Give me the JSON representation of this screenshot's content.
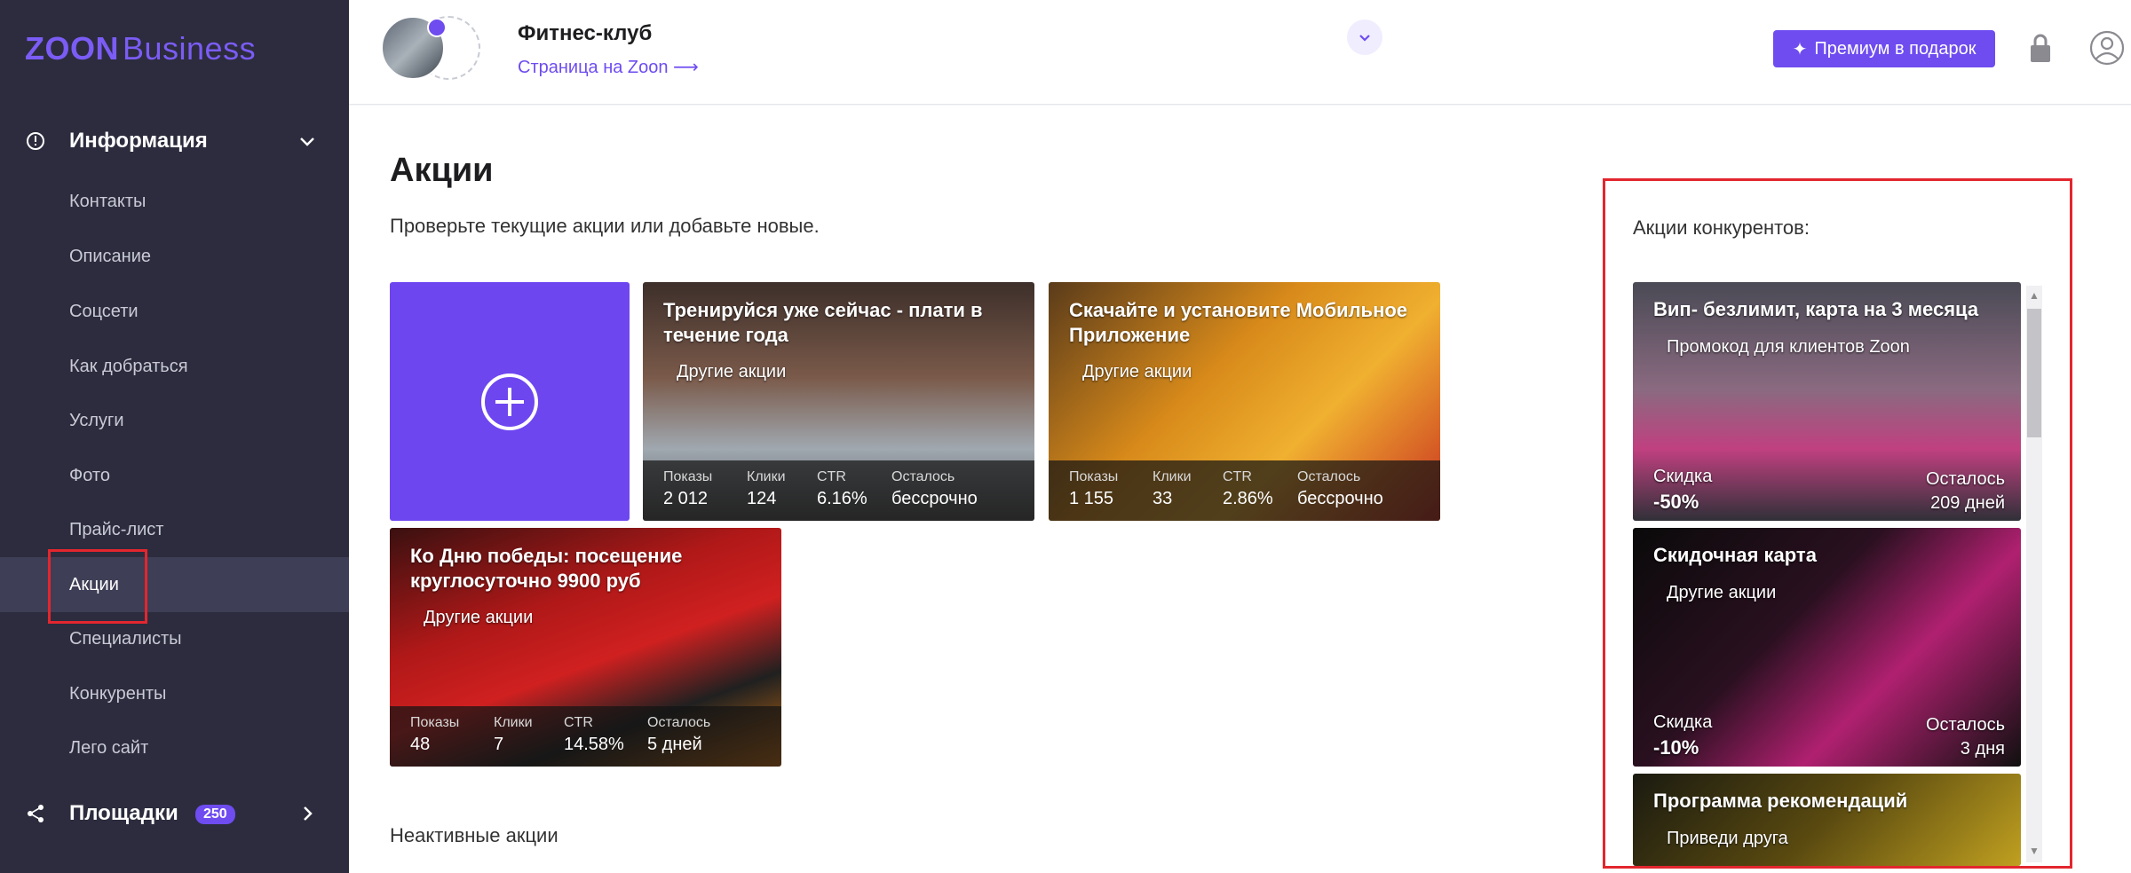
{
  "brand": {
    "logo_main": "ZOON",
    "logo_sub": "Business"
  },
  "sidebar": {
    "section_info": "Информация",
    "items": [
      {
        "label": "Контакты"
      },
      {
        "label": "Описание"
      },
      {
        "label": "Соцсети"
      },
      {
        "label": "Как добраться"
      },
      {
        "label": "Услуги"
      },
      {
        "label": "Фото"
      },
      {
        "label": "Прайс-лист"
      },
      {
        "label": "Акции"
      },
      {
        "label": "Специалисты"
      },
      {
        "label": "Конкуренты"
      },
      {
        "label": "Лего сайт"
      }
    ],
    "active_item": "Акции",
    "section_platforms": "Площадки",
    "platforms_badge": "250"
  },
  "header": {
    "club_name": "Фитнес-клуб",
    "page_link": "Страница на Zoon ⟶",
    "premium_label": "Премиум в подарок"
  },
  "main": {
    "title": "Акции",
    "subtitle": "Проверьте текущие акции или добавьте новые.",
    "inactive_label": "Неактивные акции",
    "stat_labels": {
      "views": "Показы",
      "clicks": "Клики",
      "ctr": "CTR",
      "left": "Осталось"
    },
    "promos": [
      {
        "title": "Тренируйся уже сейчас - плати в течение года",
        "tag": "Другие акции",
        "views": "2 012",
        "clicks": "124",
        "ctr": "6.16%",
        "left": "бессрочно"
      },
      {
        "title": "Скачайте и установите Мобильное Приложение",
        "tag": "Другие акции",
        "views": "1 155",
        "clicks": "33",
        "ctr": "2.86%",
        "left": "бессрочно"
      },
      {
        "title": "Ко Дню победы: посещение круглосуточно 9900 руб",
        "tag": "Другие акции",
        "views": "48",
        "clicks": "7",
        "ctr": "14.58%",
        "left": "5 дней"
      }
    ]
  },
  "competitors": {
    "title": "Акции конкурентов:",
    "discount_label": "Скидка",
    "left_label": "Осталось",
    "cards": [
      {
        "title": "Вип- безлимит, карта на 3 месяца",
        "tag": "Промокод для клиентов Zoon",
        "discount": "-50%",
        "left": "209 дней"
      },
      {
        "title": "Скидочная карта",
        "tag": "Другие акции",
        "discount": "-10%",
        "left": "3 дня"
      },
      {
        "title": "Программа рекомендаций",
        "tag": "Приведи друга"
      }
    ]
  },
  "colors": {
    "accent": "#6e4cf0",
    "sidebar_bg": "#2c2c3e",
    "highlight": "#e3262e"
  }
}
